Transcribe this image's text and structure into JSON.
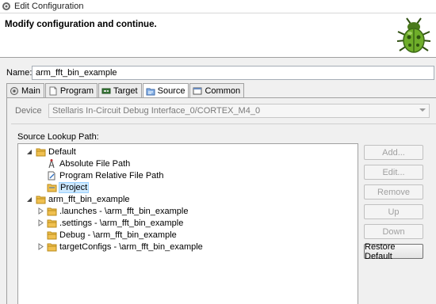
{
  "window": {
    "title": "Edit Configuration"
  },
  "header": {
    "heading": "Modify configuration and continue."
  },
  "name": {
    "label": "Name:",
    "value": "arm_fft_bin_example"
  },
  "tabs": [
    {
      "label": "Main",
      "icon": "main-tab-icon",
      "active": false
    },
    {
      "label": "Program",
      "icon": "program-page-icon",
      "active": false
    },
    {
      "label": "Target",
      "icon": "target-board-icon",
      "active": false
    },
    {
      "label": "Source",
      "icon": "source-icon",
      "active": true
    },
    {
      "label": "Common",
      "icon": "common-window-icon",
      "active": false
    }
  ],
  "device": {
    "label": "Device",
    "value": "Stellaris In-Circuit Debug Interface_0/CORTEX_M4_0"
  },
  "source_lookup": {
    "label": "Source Lookup Path:",
    "tree": [
      {
        "label": "Default",
        "expanded": true,
        "icon": "folder-icon"
      },
      {
        "label": "Absolute File Path",
        "icon": "absolute-path-icon"
      },
      {
        "label": "Program Relative File Path",
        "icon": "relative-path-icon"
      },
      {
        "label": "Project",
        "icon": "project-folder-icon",
        "selected": true
      },
      {
        "label": "arm_fft_bin_example",
        "expanded": true,
        "icon": "folder-icon"
      },
      {
        "label": ".launches - \\arm_fft_bin_example",
        "icon": "folder-icon"
      },
      {
        "label": ".settings - \\arm_fft_bin_example",
        "icon": "folder-icon"
      },
      {
        "label": "Debug - \\arm_fft_bin_example",
        "icon": "folder-icon"
      },
      {
        "label": "targetConfigs - \\arm_fft_bin_example",
        "icon": "folder-icon"
      }
    ]
  },
  "buttons": {
    "add": "Add...",
    "edit": "Edit...",
    "remove": "Remove",
    "up": "Up",
    "down": "Down",
    "restore": "Restore Default"
  },
  "colors": {
    "selection": "#cce8ff",
    "folder": "#f0c050"
  }
}
